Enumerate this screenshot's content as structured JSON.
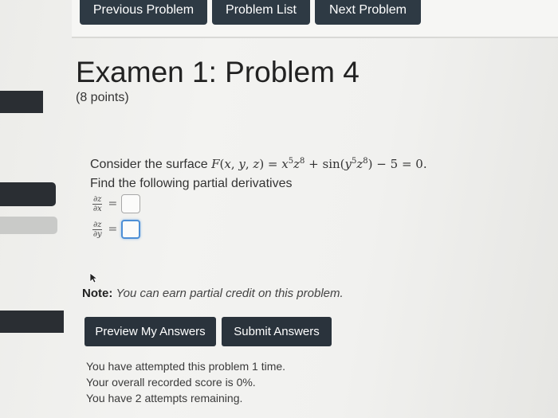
{
  "nav": {
    "previous": "Previous Problem",
    "list": "Problem List",
    "next": "Next Problem"
  },
  "header": {
    "title": "Examen 1: Problem 4",
    "points": "(8 points)"
  },
  "problem": {
    "intro": "Consider the surface ",
    "find": "Find the following partial derivatives",
    "d1_num": "∂z",
    "d1_den": "∂x",
    "d2_num": "∂z",
    "d2_den": "∂y",
    "equals": "="
  },
  "answers": {
    "a1_value": "",
    "a2_value": ""
  },
  "note": {
    "label": "Note:",
    "text": "You can earn partial credit on this problem."
  },
  "actions": {
    "preview": "Preview My Answers",
    "submit": "Submit Answers"
  },
  "status": {
    "line1": "You have attempted this problem 1 time.",
    "line2": "Your overall recorded score is 0%.",
    "line3": "You have 2 attempts remaining."
  },
  "colors": {
    "button_dark": "#2e3a44",
    "focus_blue": "#4d8fd6"
  }
}
